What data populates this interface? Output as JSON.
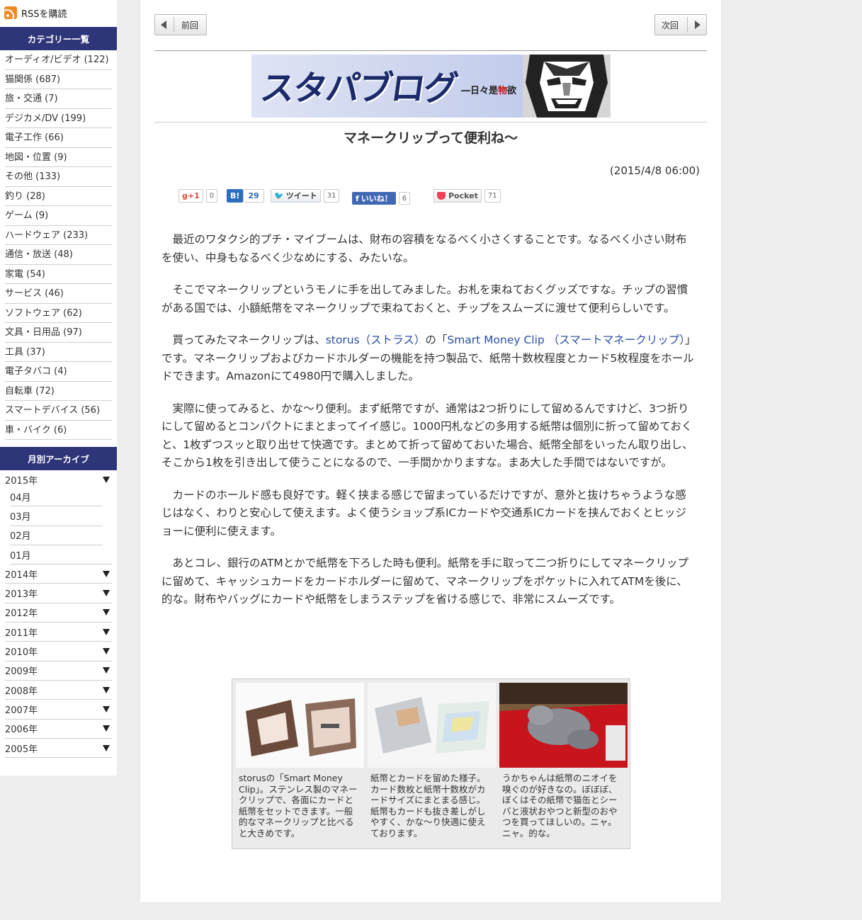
{
  "sidebar": {
    "rss_label": "RSSを購読",
    "categories_heading": "カテゴリー一覧",
    "categories": [
      "オーディオ/ビデオ (122)",
      "猫関係 (687)",
      "旅・交通 (7)",
      "デジカメ/DV (199)",
      "電子工作 (66)",
      "地図・位置 (9)",
      "その他 (133)",
      "釣り (28)",
      "ゲーム (9)",
      "ハードウェア (233)",
      "通信・放送 (48)",
      "家電 (54)",
      "サービス (46)",
      "ソフトウェア (62)",
      "文具・日用品 (97)",
      "工具 (37)",
      "電子タバコ (4)",
      "自転車 (72)",
      "スマートデバイス (56)",
      "車・バイク (6)"
    ],
    "archive_heading": "月別アーカイブ",
    "archive_open_year": "2015年",
    "archive_months": [
      "04月",
      "03月",
      "02月",
      "01月"
    ],
    "archive_years": [
      "2014年",
      "2013年",
      "2012年",
      "2011年",
      "2010年",
      "2009年",
      "2008年",
      "2007年",
      "2006年",
      "2005年"
    ]
  },
  "nav": {
    "prev_label": "前回",
    "next_label": "次回"
  },
  "banner": {
    "title": "スタパブログ",
    "subtitle_pre": "―日々是",
    "subtitle_red": "物",
    "subtitle_post": "欲"
  },
  "post": {
    "title": "マネークリップって便利ね〜",
    "date": "(2015/4/8 06:00)",
    "p1": "最近のワタクシ的プチ・マイブームは、財布の容積をなるべく小さくすることです。なるべく小さい財布を使い、中身もなるべく少なめにする、みたいな。",
    "p2": "そこでマネークリップというモノに手を出してみました。お札を束ねておくグッズですな。チップの習慣がある国では、小額紙幣をマネークリップで束ねておくと、チップをスムーズに渡せて便利らしいです。",
    "p3_pre": "買ってみたマネークリップは、",
    "p3_link1": "storus（ストラス）",
    "p3_mid": "の「",
    "p3_link2": "Smart Money Clip （スマートマネークリップ）",
    "p3_post": "」です。マネークリップおよびカードホルダーの機能を持つ製品で、紙幣十数枚程度とカード5枚程度をホールドできます。Amazonにて4980円で購入しました。",
    "p4": "実際に使ってみると、かな〜り便利。まず紙幣ですが、通常は2つ折りにして留めるんですけど、3つ折りにして留めるとコンパクトにまとまってイイ感じ。1000円札などの多用する紙幣は個別に折って留めておくと、1枚ずつスッと取り出せて快適です。まとめて折って留めておいた場合、紙幣全部をいったん取り出し、そこから1枚を引き出して使うことになるので、一手間かかりますな。まあ大した手間ではないですが。",
    "p5": "カードのホールド感も良好です。軽く挟まる感じで留まっているだけですが、意外と抜けちゃうような感じはなく、わりと安心して使えます。よく使うショップ系ICカードや交通系ICカードを挟んでおくとヒッジョーに便利に使えます。",
    "p6": "あとコレ、銀行のATMとかで紙幣を下ろした時も便利。紙幣を手に取って二つ折りにしてマネークリップに留めて、キャッシュカードをカードホルダーに留めて、マネークリップをポケットに入れてATMを後に、的な。財布やバッグにカードや紙幣をしまうステップを省ける感じで、非常にスムーズです。"
  },
  "social": {
    "gplus_label": "g+1",
    "gplus_count": "0",
    "hatena_label": "B!",
    "hatena_count": "29",
    "tweet_label": "ツイート",
    "tweet_count": "31",
    "like_label": "いいね！",
    "like_count": "6",
    "pocket_label": "Pocket",
    "pocket_count": "71"
  },
  "gallery": {
    "captions": [
      "storusの「Smart Money Clip」。ステンレス製のマネークリップで、各面にカードと紙幣をセットできます。一般的なマネークリップと比べると大きめです。",
      "紙幣とカードを留めた様子。カード数枚と紙幣十数枚がカードサイズにまとまる感じ。紙幣もカードも抜き差しがしやすく、かな〜り快適に使えております。",
      "うかちゃんは紙幣のニオイを嗅ぐのが好きなの。ぼぼぼ、ぼくはその紙幣で猫缶とシーバと液状おやつと新型のおやつを買ってほしいの。ニャ。ニャ。的な。"
    ]
  }
}
